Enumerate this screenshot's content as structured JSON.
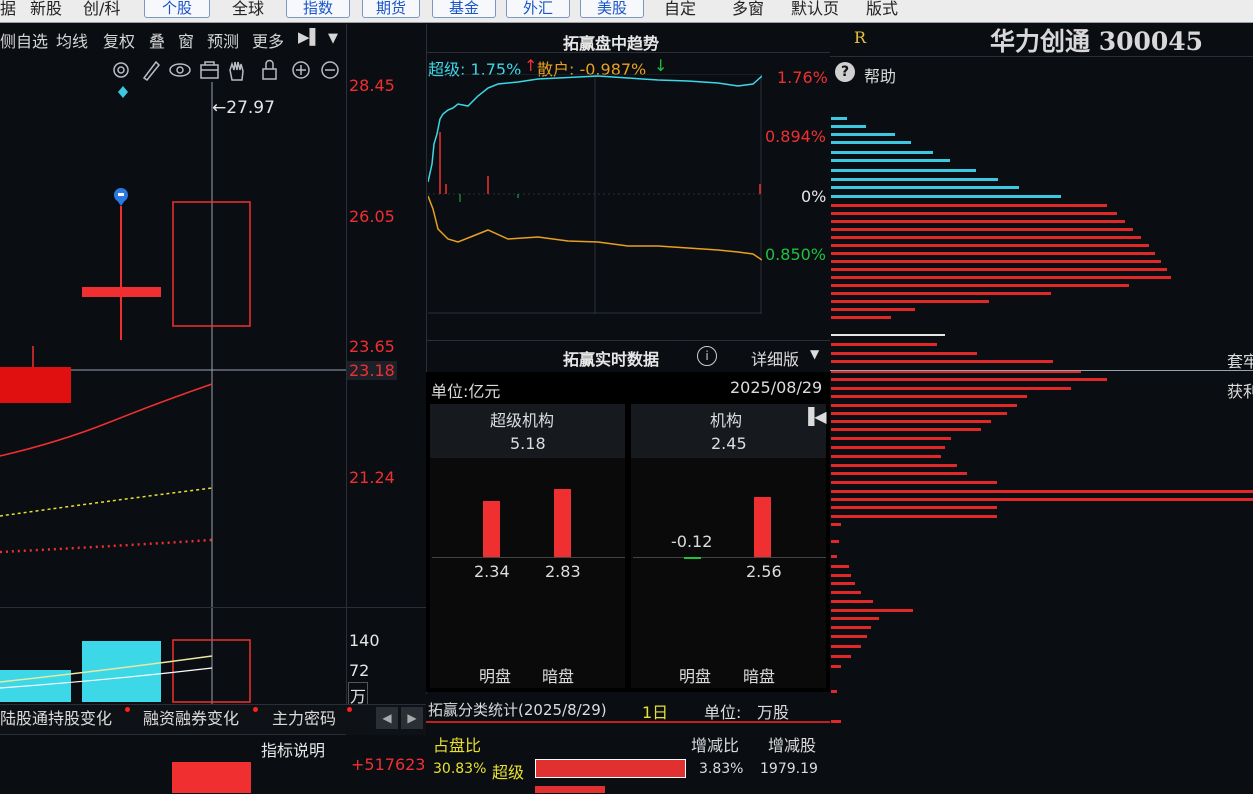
{
  "top_menu": {
    "items": [
      "据",
      "新股",
      "创/科",
      "个股",
      "全球",
      "指数",
      "期货",
      "基金",
      "外汇",
      "美股",
      "自定",
      "多窗",
      "默认页",
      "版式"
    ],
    "active": [
      "个股",
      "指数",
      "期货",
      "基金",
      "外汇",
      "美股"
    ]
  },
  "left_toolbar": {
    "items": [
      "侧自选",
      "均线",
      "复权",
      "叠",
      "窗",
      "预测",
      "更多"
    ]
  },
  "left_chart": {
    "price_labels": [
      "28.45",
      "26.05",
      "23.65",
      "23.18",
      "21.24"
    ],
    "high_marker": "27.97",
    "volume_labels": [
      "140",
      "72",
      "万"
    ],
    "bottom_value": "+517623",
    "indicator_link": "指标说明"
  },
  "left_tabs": [
    "陆股通持股变化",
    "融资融券变化",
    "主力密码"
  ],
  "trend_panel": {
    "title": "拓赢盘中趋势",
    "super_label": "超级: 1.75%",
    "retail_label": "散户: -0.987%",
    "up_arrow": "↑",
    "down_arrow": "↓",
    "axis": [
      "1.76%",
      "0.894%",
      "0%",
      "0.850%"
    ]
  },
  "realtime_panel": {
    "title": "拓赢实时数据",
    "view_mode": "详细版",
    "unit": "单位:亿元",
    "date": "2025/08/29",
    "super": {
      "name": "超级机构",
      "total": "5.18",
      "values": [
        "2.34",
        "2.83"
      ]
    },
    "inst": {
      "name": "机构",
      "total": "2.45",
      "values": [
        "-0.12",
        "2.56"
      ]
    },
    "bar_labels": [
      "明盘",
      "暗盘",
      "明盘",
      "暗盘"
    ]
  },
  "category_panel": {
    "title": "拓赢分类统计(2025/8/29)",
    "period": "1日",
    "unit_label": "单位:",
    "unit_value": "万股",
    "headers": [
      "占盘比",
      "增减比",
      "增减股"
    ],
    "rows": [
      {
        "pct": "30.83%",
        "name": "超级",
        "chg": "3.83%",
        "shares": "1979.19"
      }
    ]
  },
  "right_panel": {
    "r_mark": "R",
    "stock_title": "华力创通 300045",
    "help": "帮助",
    "side_labels": [
      "套牢",
      "获利"
    ]
  },
  "colors": {
    "up": "#f03030",
    "down": "#20c040",
    "cyan": "#3cd8e8",
    "orange": "#e8a020"
  }
}
